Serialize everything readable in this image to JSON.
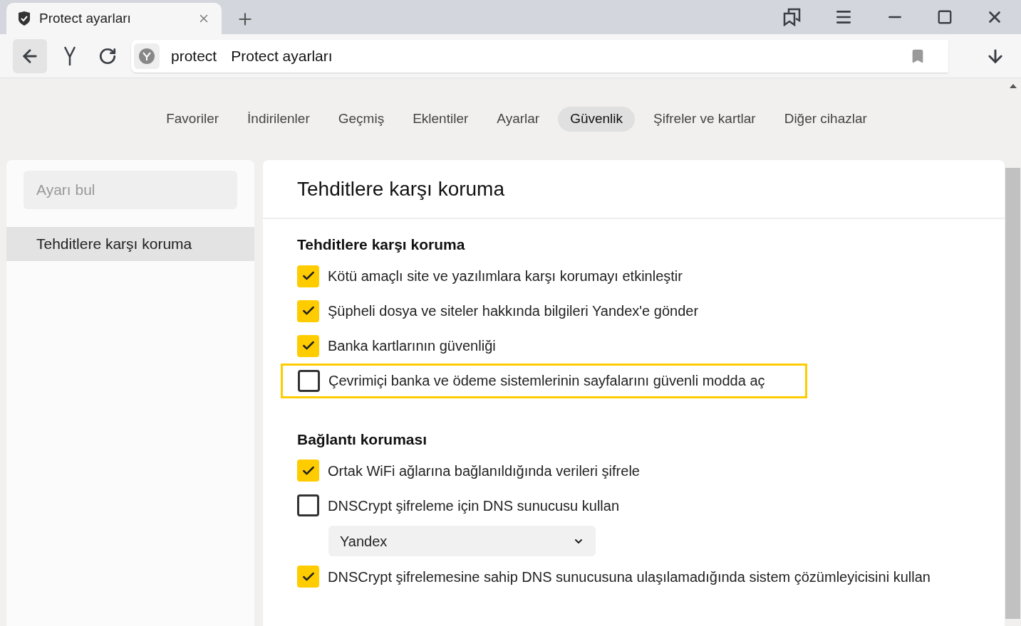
{
  "tab": {
    "title": "Protect ayarları"
  },
  "address": {
    "query": "protect",
    "title": "Protect ayarları"
  },
  "nav": [
    {
      "label": "Favoriler",
      "selected": false
    },
    {
      "label": "İndirilenler",
      "selected": false
    },
    {
      "label": "Geçmiş",
      "selected": false
    },
    {
      "label": "Eklentiler",
      "selected": false
    },
    {
      "label": "Ayarlar",
      "selected": false
    },
    {
      "label": "Güvenlik",
      "selected": true
    },
    {
      "label": "Şifreler ve kartlar",
      "selected": false
    },
    {
      "label": "Diğer cihazlar",
      "selected": false
    }
  ],
  "sidebar": {
    "search": {
      "placeholder": "Ayarı bul"
    },
    "items": [
      {
        "label": "Tehditlere karşı koruma",
        "selected": true
      }
    ]
  },
  "page": {
    "title": "Tehditlere karşı koruma",
    "sections": [
      {
        "heading": "Tehditlere karşı koruma",
        "items": [
          {
            "kind": "checkbox",
            "label": "Kötü amaçlı site ve yazılımlara karşı korumayı etkinleştir",
            "checked": true,
            "highlighted": false
          },
          {
            "kind": "checkbox",
            "label": "Şüpheli dosya ve siteler hakkında bilgileri Yandex'e gönder",
            "checked": true,
            "highlighted": false
          },
          {
            "kind": "checkbox",
            "label": "Banka kartlarının güvenliği",
            "checked": true,
            "highlighted": false
          },
          {
            "kind": "checkbox",
            "label": "Çevrimiçi banka ve ödeme sistemlerinin sayfalarını güvenli modda aç",
            "checked": false,
            "highlighted": true
          }
        ]
      },
      {
        "heading": "Bağlantı koruması",
        "items": [
          {
            "kind": "checkbox",
            "label": "Ortak WiFi ağlarına bağlanıldığında verileri şifrele",
            "checked": true,
            "highlighted": false
          },
          {
            "kind": "checkbox",
            "label": "DNSCrypt şifreleme için DNS sunucusu kullan",
            "checked": false,
            "highlighted": false
          },
          {
            "kind": "select",
            "value": "Yandex"
          },
          {
            "kind": "checkbox",
            "label": "DNSCrypt şifrelemesine sahip DNS sunucusuna ulaşılamadığında sistem çözümleyicisini kullan",
            "checked": true,
            "highlighted": false
          }
        ]
      }
    ]
  }
}
